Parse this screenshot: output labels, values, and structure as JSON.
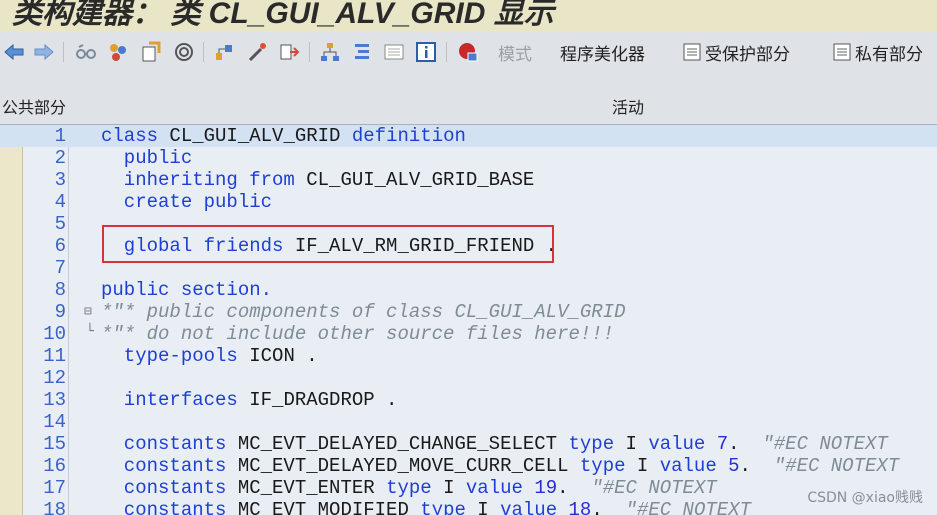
{
  "window": {
    "title": "类构建器： 类 CL_GUI_ALV_GRID 显示"
  },
  "toolbar": {
    "icons": [
      "back-icon",
      "forward-icon",
      "other-object-icon",
      "display-change-icon",
      "activate-icon",
      "check-icon",
      "where-used-icon",
      "test-icon",
      "object-list-icon",
      "enhance-icon",
      "hierarchy-icon",
      "outline-icon",
      "list-icon",
      "info-icon",
      "help-icon"
    ],
    "mode_label": "模式",
    "pretty_printer_label": "程序美化器",
    "protected_section_label": "受保护部分",
    "private_section_label": "私有部分"
  },
  "subbar": {
    "section_label": "公共部分",
    "status_label": "活动"
  },
  "code": {
    "lines": [
      {
        "n": "1",
        "segs": [
          [
            "kw",
            "class "
          ],
          [
            "plain",
            "CL_GUI_ALV_GRID "
          ],
          [
            "kw",
            "definition"
          ]
        ]
      },
      {
        "n": "2",
        "segs": [
          [
            "kw",
            "  public"
          ]
        ]
      },
      {
        "n": "3",
        "segs": [
          [
            "kw",
            "  inheriting from "
          ],
          [
            "plain",
            "CL_GUI_ALV_GRID_BASE"
          ]
        ]
      },
      {
        "n": "4",
        "segs": [
          [
            "kw",
            "  create public"
          ]
        ]
      },
      {
        "n": "5",
        "segs": []
      },
      {
        "n": "6",
        "segs": [
          [
            "kw",
            "  global friends "
          ],
          [
            "plain",
            "IF_ALV_RM_GRID_FRIEND ."
          ]
        ]
      },
      {
        "n": "7",
        "segs": []
      },
      {
        "n": "8",
        "segs": [
          [
            "kw",
            "public section."
          ]
        ]
      },
      {
        "n": "9",
        "segs": [
          [
            "cm",
            "*\"* public components of class CL_GUI_ALV_GRID"
          ]
        ]
      },
      {
        "n": "10",
        "segs": [
          [
            "cm",
            "*\"* do not include other source files here!!!"
          ]
        ]
      },
      {
        "n": "11",
        "segs": [
          [
            "kw",
            "  type-pools "
          ],
          [
            "plain",
            "ICON ."
          ]
        ]
      },
      {
        "n": "12",
        "segs": []
      },
      {
        "n": "13",
        "segs": [
          [
            "kw",
            "  interfaces "
          ],
          [
            "plain",
            "IF_DRAGDROP ."
          ]
        ]
      },
      {
        "n": "14",
        "segs": []
      },
      {
        "n": "15",
        "segs": [
          [
            "kw",
            "  constants "
          ],
          [
            "plain",
            "MC_EVT_DELAYED_CHANGE_SELECT "
          ],
          [
            "kw",
            "type "
          ],
          [
            "plain",
            "I "
          ],
          [
            "kw",
            "value "
          ],
          [
            "num",
            "7"
          ],
          [
            "plain",
            ".  "
          ],
          [
            "cm",
            "\"#EC NOTEXT"
          ]
        ]
      },
      {
        "n": "16",
        "segs": [
          [
            "kw",
            "  constants "
          ],
          [
            "plain",
            "MC_EVT_DELAYED_MOVE_CURR_CELL "
          ],
          [
            "kw",
            "type "
          ],
          [
            "plain",
            "I "
          ],
          [
            "kw",
            "value "
          ],
          [
            "num",
            "5"
          ],
          [
            "plain",
            ".  "
          ],
          [
            "cm",
            "\"#EC NOTEXT"
          ]
        ]
      },
      {
        "n": "17",
        "segs": [
          [
            "kw",
            "  constants "
          ],
          [
            "plain",
            "MC_EVT_ENTER "
          ],
          [
            "kw",
            "type "
          ],
          [
            "plain",
            "I "
          ],
          [
            "kw",
            "value "
          ],
          [
            "num",
            "19"
          ],
          [
            "plain",
            ".  "
          ],
          [
            "cm",
            "\"#EC NOTEXT"
          ]
        ]
      },
      {
        "n": "18",
        "segs": [
          [
            "kw",
            "  constants "
          ],
          [
            "plain",
            "MC_EVT_MODIFIED "
          ],
          [
            "kw",
            "type "
          ],
          [
            "plain",
            "I "
          ],
          [
            "kw",
            "value "
          ],
          [
            "num",
            "18"
          ],
          [
            "plain",
            ".  "
          ],
          [
            "cm",
            "\"#EC NOTEXT"
          ]
        ]
      }
    ]
  },
  "watermark": "CSDN @xiao贱贱"
}
